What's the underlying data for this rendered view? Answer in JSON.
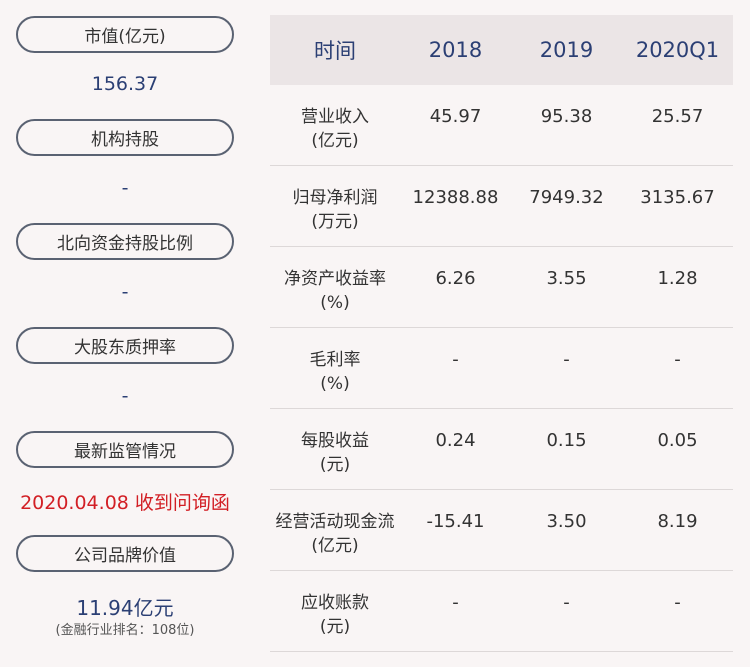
{
  "left": {
    "items": [
      {
        "label": "市值(亿元)",
        "value": "156.37"
      },
      {
        "label": "机构持股",
        "value": "-"
      },
      {
        "label": "北向资金持股比例",
        "value": "-"
      },
      {
        "label": "大股东质押率",
        "value": "-"
      },
      {
        "label": "最新监管情况",
        "value": "2020.04.08 收到问询函"
      },
      {
        "label": "公司品牌价值",
        "value": "11.94亿元",
        "note": "(金融行业排名：108位)"
      }
    ]
  },
  "table": {
    "headers": [
      "时间",
      "2018",
      "2019",
      "2020Q1"
    ],
    "rows": [
      {
        "name": "营业收入",
        "unit": "(亿元)",
        "values": [
          "45.97",
          "95.38",
          "25.57"
        ]
      },
      {
        "name": "归母净利润",
        "unit": "(万元)",
        "values": [
          "12388.88",
          "7949.32",
          "3135.67"
        ]
      },
      {
        "name": "净资产收益率",
        "unit": "(%)",
        "values": [
          "6.26",
          "3.55",
          "1.28"
        ]
      },
      {
        "name": "毛利率",
        "unit": "(%)",
        "values": [
          "-",
          "-",
          "-"
        ]
      },
      {
        "name": "每股收益",
        "unit": "(元)",
        "values": [
          "0.24",
          "0.15",
          "0.05"
        ]
      },
      {
        "name": "经营活动现金流",
        "unit": "(亿元)",
        "values": [
          "-15.41",
          "3.50",
          "8.19"
        ]
      },
      {
        "name": "应收账款",
        "unit": "(元)",
        "values": [
          "-",
          "-",
          "-"
        ]
      }
    ]
  },
  "colors": {
    "background": "#f9f5f5",
    "header_bg": "#ebe5e6",
    "value_blue": "#2b3f74",
    "alert_red": "#d21f25",
    "pill_border": "#5a6272"
  }
}
